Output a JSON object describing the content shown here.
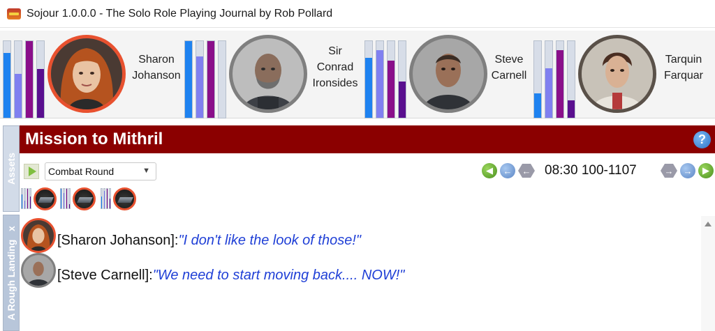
{
  "window": {
    "title": "Sojour 1.0.0.0 - The Solo Role Playing Journal by Rob Pollard"
  },
  "party": {
    "members": [
      {
        "name_lines": [
          "Sharon",
          "Johanson"
        ],
        "stats": [
          0.85,
          0.57,
          1.0,
          0.64
        ],
        "stat_colors": [
          "#1e82f0",
          "#8080f0",
          "#8a0f8a",
          "#5a0f8f"
        ]
      },
      {
        "name_lines": [
          "Sir",
          "Conrad",
          "Ironsides"
        ],
        "stats": [
          1.0,
          0.8,
          1.0,
          0.0
        ],
        "stat_colors": [
          "#1e82f0",
          "#8080f0",
          "#8a0f8a",
          "#5a0f8f"
        ]
      },
      {
        "name_lines": [
          "Steve",
          "Carnell"
        ],
        "stats": [
          0.78,
          0.88,
          0.75,
          0.47
        ],
        "stat_colors": [
          "#1e82f0",
          "#8080f0",
          "#8a0f8a",
          "#5a0f8f"
        ]
      },
      {
        "name_lines": [
          "Tarquin",
          "Farquar"
        ],
        "stats": [
          0.32,
          0.65,
          0.88,
          0.23
        ],
        "stat_colors": [
          "#1e82f0",
          "#8080f0",
          "#8a0f8a",
          "#5a0f8f"
        ]
      }
    ]
  },
  "side_tabs": {
    "assets": "Assets",
    "scene": "A Rough Landing",
    "close": "x"
  },
  "mission": {
    "title": "Mission to Mithril",
    "help": "?"
  },
  "toolbar": {
    "entry_type": "Combat Round",
    "timestamp": "08:30 100-1107"
  },
  "journal": {
    "entries": [
      {
        "speaker": "[Sharon Johanson]:",
        "text": "\"I don't like the look of those!\""
      },
      {
        "speaker": "[Steve Carnell]:",
        "text": "\"We need to start moving back.... NOW!\""
      }
    ]
  },
  "colors": {
    "accent_red": "#8b0000",
    "portrait_ring": "#e8512f",
    "quote_blue": "#1f3fd6"
  }
}
